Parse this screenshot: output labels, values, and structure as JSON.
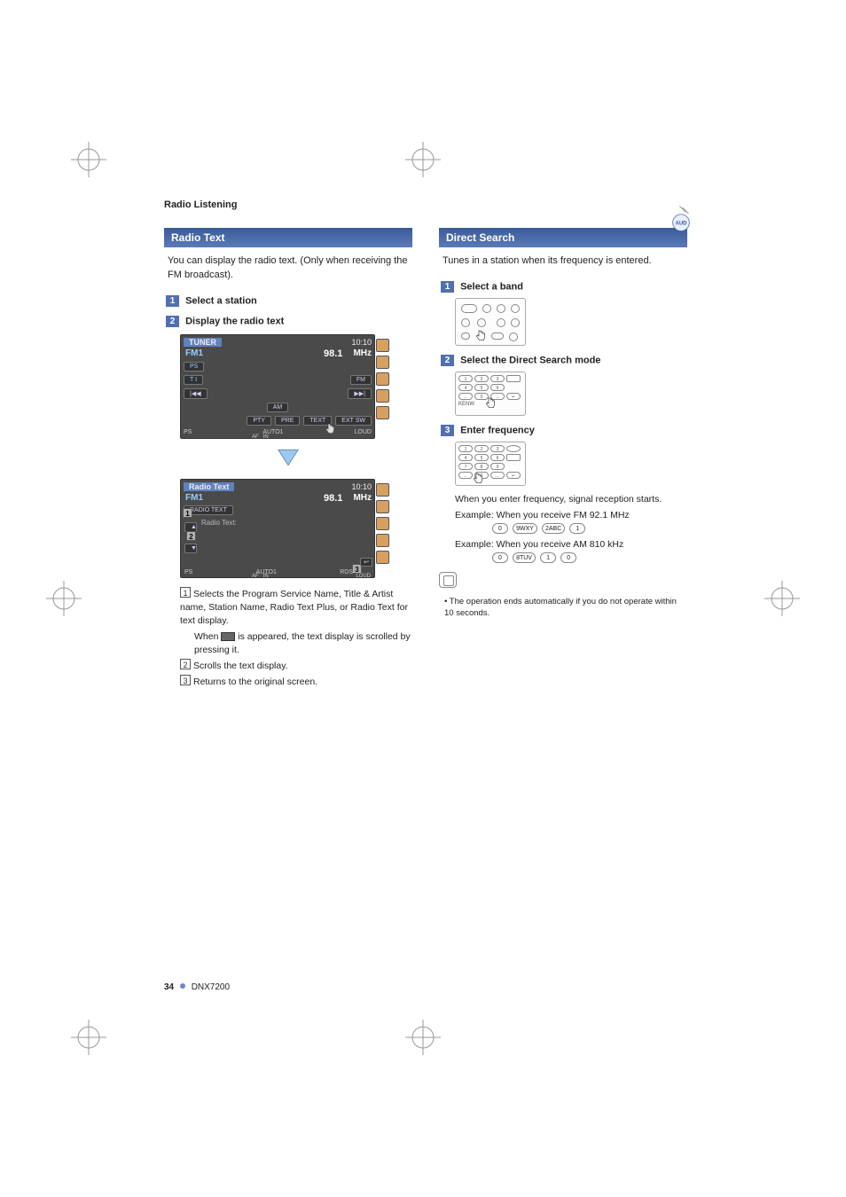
{
  "header": {
    "breadcrumb": "Radio Listening"
  },
  "left": {
    "section_title": "Radio Text",
    "intro": "You can display the radio text. (Only when receiving the FM broadcast).",
    "steps": {
      "s1": {
        "num": "1",
        "label": "Select a station"
      },
      "s2": {
        "num": "2",
        "label": "Display the radio text"
      }
    },
    "screen1": {
      "title": "TUNER",
      "time": "10:10",
      "band": "FM1",
      "freq": "98.1",
      "unit": "MHz",
      "btn_ps": "PS",
      "btn_ti": "T I",
      "btn_fm": "FM",
      "btn_am": "AM",
      "btn_prev": "|◀◀",
      "btn_next": "▶▶|",
      "btn_pty": "PTY",
      "btn_pre": "PRE",
      "btn_text": "TEXT",
      "btn_extsw": "EXT SW",
      "foot_ps": "PS",
      "foot_auto": "AUTO1",
      "foot_af": "AF",
      "foot_in": "IN",
      "foot_loud": "LOUD"
    },
    "screen2": {
      "title": "Radio Text",
      "time": "10:10",
      "band": "FM1",
      "freq": "98.1",
      "unit": "MHz",
      "btn_radiotext": "RADIO TEXT",
      "label_radiotext": "Radio Text:",
      "foot_ps": "PS",
      "foot_auto": "AUTO1",
      "foot_af": "AF",
      "foot_in": "IN",
      "foot_rds": "RDS",
      "foot_loud": "LOUD",
      "co1": "1",
      "co2": "2",
      "co3": "3"
    },
    "notes": {
      "n1a": "Selects the Program Service Name, Title & Artist name, Station Name, Radio Text Plus, or Radio Text for text display.",
      "n1b_pre": "When ",
      "n1b_post": " is appeared, the text display is scrolled by pressing it.",
      "n2": "Scrolls the text display.",
      "n3": "Returns to the original screen.",
      "ref1": "1",
      "ref2": "2",
      "ref3": "3"
    }
  },
  "right": {
    "section_title": "Direct Search",
    "intro": "Tunes in a station when its frequency is entered.",
    "steps": {
      "s1": {
        "num": "1",
        "label": "Select a band"
      },
      "s2": {
        "num": "2",
        "label": "Select the Direct Search mode"
      },
      "s3": {
        "num": "3",
        "label": "Enter frequency"
      }
    },
    "sub_text": "When you enter frequency, signal reception starts.",
    "example1_label": "Example: When you receive FM 92.1 MHz",
    "example1_keys": [
      "0",
      "9WXY",
      "2ABC",
      "1"
    ],
    "example2_label": "Example: When you receive AM 810 kHz",
    "example2_keys": [
      "0",
      "8TUV",
      "1",
      "0"
    ],
    "tip": "The operation ends automatically if you do not operate within 10 seconds.",
    "keypad_label": "KENW"
  },
  "footer": {
    "page": "34",
    "model": "DNX7200"
  }
}
